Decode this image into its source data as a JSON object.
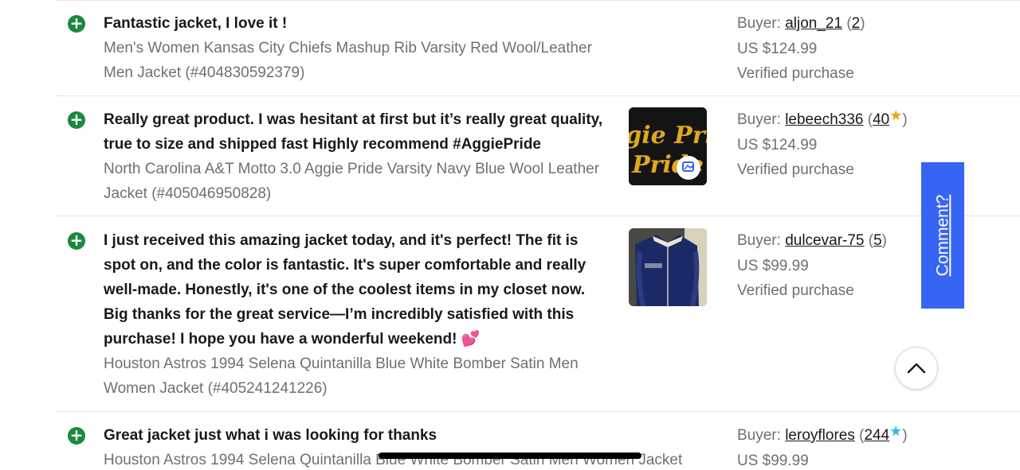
{
  "feedback": [
    {
      "comment": "Fantastic jacket, I love it !",
      "item": "Men's Women Kansas City Chiefs Mashup Rib Varsity Red Wool/Leather Men Jacket (#404830592379)",
      "buyer_label": "Buyer:",
      "buyer": "aljon_21",
      "score": "2",
      "star": "",
      "price": "US $124.99",
      "status": "Verified purchase",
      "has_photo": false
    },
    {
      "comment": "Really great product. I was hesitant at first but it’s really great quality, true to size and shipped fast Highly recommend #AggiePride",
      "item": "North Carolina A&T Motto 3.0 Aggie Pride Varsity Navy Blue Wool Leather Jacket (#405046950828)",
      "buyer_label": "Buyer:",
      "buyer": "lebeech336",
      "score": "40",
      "star": "gold-star-icon",
      "price": "US $124.99",
      "status": "Verified purchase",
      "has_photo": true,
      "photo_text": "Aggie Pride"
    },
    {
      "comment": "I just received this amazing jacket today, and it's perfect! The fit is spot on, and the color is fantastic. It's super comfortable and really well-made. Honestly, it's one of the coolest items in my closet now. Big thanks for the great service—I’m incredibly satisfied with this purchase! I hope you have a wonderful weekend! 💕",
      "item": "Houston Astros 1994 Selena Quintanilla Blue White Bomber Satin Men Women Jacket (#405241241226)",
      "buyer_label": "Buyer:",
      "buyer": "dulcevar-75",
      "score": "5",
      "star": "",
      "price": "US $99.99",
      "status": "Verified purchase",
      "has_photo": true
    },
    {
      "comment": "Great jacket just what i was looking for thanks",
      "item": "Houston Astros 1994 Selena Quintanilla Blue White Bomber Satin Men Women Jacket",
      "buyer_label": "Buyer:",
      "buyer": "leroyflores",
      "score": "244",
      "star": "teal-star-icon",
      "price": "US $99.99",
      "status": "",
      "has_photo": false
    }
  ],
  "comment_tab": {
    "label": "Comment?"
  },
  "colors": {
    "positive": "#1a8a3c",
    "accent": "#3665f3",
    "gold_star": "#f0a500",
    "teal_star": "#1fc3e0"
  },
  "icons": {
    "positive": "plus-circle-icon",
    "scroll_top": "chevron-up-icon",
    "photo_badge": "gallery-icon"
  }
}
